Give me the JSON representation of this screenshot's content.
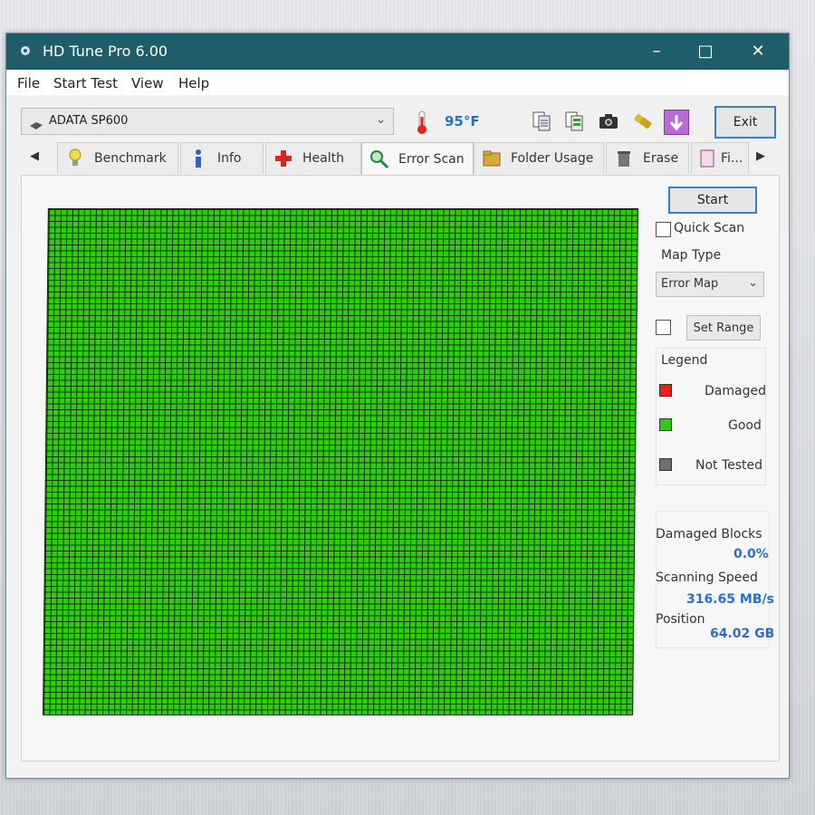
{
  "window": {
    "title": "HD Tune Pro 6.00"
  },
  "menu": [
    "File",
    "Start Test",
    "View",
    "Help"
  ],
  "toolbar": {
    "drive": "ADATA SP600",
    "temperature": "95°F",
    "exit_label": "Exit"
  },
  "tabs": [
    {
      "label": "Benchmark",
      "icon": "lightbulb-icon"
    },
    {
      "label": "Info",
      "icon": "info-icon"
    },
    {
      "label": "Health",
      "icon": "health-cross-icon"
    },
    {
      "label": "Error Scan",
      "icon": "magnifier-icon",
      "active": true
    },
    {
      "label": "Folder Usage",
      "icon": "folder-icon"
    },
    {
      "label": "Erase",
      "icon": "trash-icon"
    },
    {
      "label": "Fi...",
      "icon": "file-icon"
    }
  ],
  "error_scan": {
    "start_label": "Start",
    "quick_scan_label": "Quick Scan",
    "quick_scan_checked": false,
    "map_type_label": "Map Type",
    "map_type_value": "Error Map",
    "set_range_label": "Set Range",
    "set_range_checked": false,
    "legend_title": "Legend",
    "legend": [
      {
        "label": "Damaged",
        "color": "#e0261b"
      },
      {
        "label": "Good",
        "color": "#2fcc10"
      },
      {
        "label": "Not Tested",
        "color": "#6e6e6e"
      }
    ],
    "damaged_blocks_label": "Damaged Blocks",
    "damaged_blocks_value": "0.0%",
    "scanning_speed_label": "Scanning Speed",
    "scanning_speed_value": "316.65 MB/s",
    "position_label": "Position",
    "position_value": "64.02 GB",
    "map_state": "all-good",
    "map_color": "#2fcc10"
  }
}
